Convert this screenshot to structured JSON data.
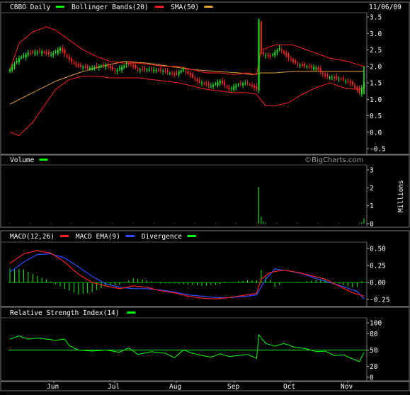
{
  "chart_data": [
    {
      "type": "candlestick",
      "title": "CBBO Daily",
      "date": "11/06/09",
      "legend": [
        {
          "label": "CBBO Daily",
          "color": "#00ff00"
        },
        {
          "label": "Bollinger Bands(20)",
          "color": "#ff2020"
        },
        {
          "label": "SMA(50)",
          "color": "#e8a030"
        }
      ],
      "ylim": [
        -0.5,
        3.5
      ],
      "yticks": [
        "3.5",
        "3.0",
        "2.5",
        "2.0",
        "1.5",
        "1.0",
        "0.5",
        "0.0",
        "-0.5"
      ],
      "xticks": [
        "Jun",
        "Jul",
        "Aug",
        "Sep",
        "Oct",
        "Nov"
      ],
      "watermark": "©BigCharts.com",
      "up_color": "#00ff00",
      "down_color": "#ff2020",
      "close_anchors": [
        [
          0,
          1.9
        ],
        [
          4,
          2.25
        ],
        [
          8,
          2.4
        ],
        [
          14,
          2.45
        ],
        [
          18,
          2.35
        ],
        [
          22,
          2.55
        ],
        [
          26,
          2.2
        ],
        [
          30,
          2.0
        ],
        [
          36,
          1.95
        ],
        [
          42,
          2.05
        ],
        [
          46,
          1.85
        ],
        [
          52,
          2.1
        ],
        [
          56,
          1.9
        ],
        [
          62,
          1.9
        ],
        [
          68,
          1.85
        ],
        [
          72,
          1.75
        ],
        [
          76,
          1.9
        ],
        [
          82,
          1.55
        ],
        [
          88,
          1.4
        ],
        [
          92,
          1.55
        ],
        [
          96,
          1.3
        ],
        [
          100,
          1.45
        ],
        [
          104,
          1.5
        ],
        [
          108,
          1.3
        ],
        [
          109,
          3.35
        ],
        [
          110,
          2.4
        ],
        [
          114,
          2.3
        ],
        [
          118,
          2.55
        ],
        [
          122,
          2.25
        ],
        [
          126,
          2.05
        ],
        [
          130,
          2.0
        ],
        [
          134,
          1.95
        ],
        [
          138,
          1.7
        ],
        [
          142,
          1.65
        ],
        [
          146,
          1.6
        ],
        [
          150,
          1.45
        ],
        [
          153,
          1.2
        ],
        [
          155,
          1.5
        ]
      ],
      "upper_anchors": [
        [
          0,
          1.9
        ],
        [
          4,
          2.7
        ],
        [
          10,
          3.05
        ],
        [
          16,
          3.2
        ],
        [
          20,
          3.1
        ],
        [
          26,
          2.8
        ],
        [
          32,
          2.5
        ],
        [
          38,
          2.3
        ],
        [
          44,
          2.15
        ],
        [
          50,
          2.1
        ],
        [
          56,
          2.1
        ],
        [
          62,
          2.05
        ],
        [
          68,
          2.0
        ],
        [
          74,
          2.0
        ],
        [
          80,
          1.9
        ],
        [
          86,
          1.8
        ],
        [
          92,
          1.8
        ],
        [
          98,
          1.75
        ],
        [
          104,
          1.8
        ],
        [
          108,
          1.75
        ],
        [
          110,
          2.5
        ],
        [
          116,
          2.65
        ],
        [
          124,
          2.65
        ],
        [
          132,
          2.45
        ],
        [
          140,
          2.25
        ],
        [
          148,
          2.15
        ],
        [
          155,
          2.0
        ]
      ],
      "lower_anchors": [
        [
          0,
          0.0
        ],
        [
          4,
          -0.1
        ],
        [
          10,
          0.3
        ],
        [
          16,
          0.9
        ],
        [
          20,
          1.3
        ],
        [
          26,
          1.6
        ],
        [
          32,
          1.7
        ],
        [
          38,
          1.7
        ],
        [
          44,
          1.65
        ],
        [
          50,
          1.65
        ],
        [
          56,
          1.65
        ],
        [
          62,
          1.6
        ],
        [
          68,
          1.55
        ],
        [
          74,
          1.5
        ],
        [
          80,
          1.4
        ],
        [
          86,
          1.3
        ],
        [
          92,
          1.25
        ],
        [
          98,
          1.2
        ],
        [
          104,
          1.2
        ],
        [
          108,
          1.15
        ],
        [
          112,
          0.8
        ],
        [
          116,
          0.8
        ],
        [
          122,
          0.9
        ],
        [
          128,
          1.15
        ],
        [
          134,
          1.35
        ],
        [
          140,
          1.5
        ],
        [
          146,
          1.35
        ],
        [
          152,
          1.3
        ],
        [
          155,
          1.35
        ]
      ],
      "sma_anchors": [
        [
          0,
          0.85
        ],
        [
          10,
          1.2
        ],
        [
          20,
          1.55
        ],
        [
          30,
          1.8
        ],
        [
          40,
          2.0
        ],
        [
          50,
          2.15
        ],
        [
          60,
          2.1
        ],
        [
          70,
          2.0
        ],
        [
          80,
          1.9
        ],
        [
          90,
          1.85
        ],
        [
          100,
          1.8
        ],
        [
          106,
          1.75
        ],
        [
          110,
          1.8
        ],
        [
          116,
          1.8
        ],
        [
          124,
          1.85
        ],
        [
          132,
          1.85
        ],
        [
          140,
          1.85
        ],
        [
          148,
          1.85
        ],
        [
          155,
          1.85
        ]
      ]
    },
    {
      "type": "bar",
      "title": "Volume",
      "legend": [
        {
          "label": "Volume",
          "color": "#00ff00"
        }
      ],
      "ylabel": "Millions",
      "ylim": [
        0,
        3
      ],
      "yticks": [
        "3",
        "2",
        "1",
        "0"
      ],
      "spikes": [
        [
          109,
          2.05
        ],
        [
          110,
          0.4
        ],
        [
          111,
          0.12
        ],
        [
          112,
          0.06
        ],
        [
          154,
          0.08
        ],
        [
          155,
          0.3
        ]
      ],
      "base_level": 0.03,
      "color": "#00ff00"
    },
    {
      "type": "line",
      "title": "MACD(12,26)",
      "legend": [
        {
          "label": "MACD(12,26)",
          "color": "#ff2020"
        },
        {
          "label": "MACD EMA(9)",
          "color": "#2a4cff"
        },
        {
          "label": "Divergence",
          "color": "#00ff00"
        }
      ],
      "ylim": [
        -0.3,
        0.52
      ],
      "yticks": [
        "0.50",
        "0.25",
        "0.00",
        "-0.25"
      ],
      "macd_anchors": [
        [
          0,
          0.28
        ],
        [
          6,
          0.42
        ],
        [
          12,
          0.47
        ],
        [
          18,
          0.43
        ],
        [
          24,
          0.3
        ],
        [
          30,
          0.12
        ],
        [
          36,
          0.0
        ],
        [
          42,
          -0.05
        ],
        [
          48,
          -0.09
        ],
        [
          54,
          -0.05
        ],
        [
          60,
          -0.07
        ],
        [
          66,
          -0.12
        ],
        [
          72,
          -0.15
        ],
        [
          78,
          -0.2
        ],
        [
          84,
          -0.23
        ],
        [
          90,
          -0.24
        ],
        [
          96,
          -0.22
        ],
        [
          100,
          -0.2
        ],
        [
          104,
          -0.18
        ],
        [
          108,
          -0.16
        ],
        [
          110,
          0.05
        ],
        [
          114,
          0.15
        ],
        [
          120,
          0.18
        ],
        [
          126,
          0.15
        ],
        [
          132,
          0.1
        ],
        [
          138,
          0.05
        ],
        [
          144,
          -0.05
        ],
        [
          150,
          -0.15
        ],
        [
          155,
          -0.2
        ]
      ],
      "ema_anchors": [
        [
          0,
          0.15
        ],
        [
          6,
          0.3
        ],
        [
          12,
          0.41
        ],
        [
          18,
          0.42
        ],
        [
          24,
          0.36
        ],
        [
          30,
          0.23
        ],
        [
          36,
          0.09
        ],
        [
          42,
          -0.02
        ],
        [
          48,
          -0.07
        ],
        [
          54,
          -0.09
        ],
        [
          60,
          -0.09
        ],
        [
          66,
          -0.11
        ],
        [
          72,
          -0.14
        ],
        [
          78,
          -0.18
        ],
        [
          84,
          -0.2
        ],
        [
          90,
          -0.22
        ],
        [
          96,
          -0.22
        ],
        [
          100,
          -0.21
        ],
        [
          104,
          -0.2
        ],
        [
          108,
          -0.18
        ],
        [
          112,
          0.05
        ],
        [
          116,
          0.2
        ],
        [
          122,
          0.17
        ],
        [
          128,
          0.13
        ],
        [
          134,
          0.06
        ],
        [
          140,
          0.0
        ],
        [
          146,
          -0.06
        ],
        [
          152,
          -0.13
        ],
        [
          155,
          -0.24
        ]
      ]
    },
    {
      "type": "line",
      "title": "Relative Strength Index(14)",
      "legend": [
        {
          "label": "Relative Strength Index(14)",
          "color": "#00ff00"
        }
      ],
      "ylim": [
        0,
        100
      ],
      "yticks": [
        "100",
        "80",
        "50",
        "20",
        "0"
      ],
      "reference_line": 50,
      "rsi_anchors": [
        [
          0,
          70
        ],
        [
          4,
          76
        ],
        [
          8,
          70
        ],
        [
          12,
          72
        ],
        [
          16,
          70
        ],
        [
          20,
          68
        ],
        [
          24,
          70
        ],
        [
          26,
          58
        ],
        [
          30,
          50
        ],
        [
          36,
          48
        ],
        [
          42,
          50
        ],
        [
          48,
          46
        ],
        [
          52,
          54
        ],
        [
          56,
          42
        ],
        [
          62,
          47
        ],
        [
          68,
          44
        ],
        [
          72,
          36
        ],
        [
          76,
          50
        ],
        [
          80,
          44
        ],
        [
          84,
          40
        ],
        [
          88,
          37
        ],
        [
          92,
          43
        ],
        [
          96,
          38
        ],
        [
          100,
          40
        ],
        [
          104,
          42
        ],
        [
          108,
          35
        ],
        [
          109,
          78
        ],
        [
          112,
          62
        ],
        [
          116,
          57
        ],
        [
          120,
          62
        ],
        [
          124,
          56
        ],
        [
          130,
          52
        ],
        [
          134,
          47
        ],
        [
          138,
          48
        ],
        [
          142,
          40
        ],
        [
          146,
          41
        ],
        [
          150,
          34
        ],
        [
          153,
          29
        ],
        [
          155,
          45
        ]
      ]
    }
  ]
}
